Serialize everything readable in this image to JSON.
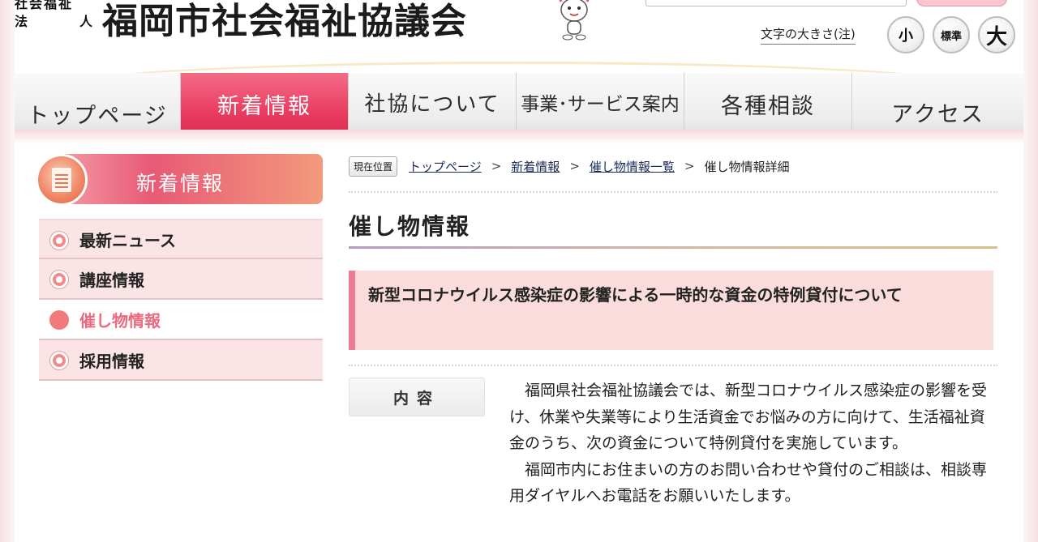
{
  "header": {
    "org_type_line1": "社会福祉",
    "org_type_line2_a": "法",
    "org_type_line2_b": "人",
    "org_name": "福岡市社会福祉協議会",
    "fontsize_label": "文字の大きさ(注)",
    "fontsize_small": "小",
    "fontsize_standard": "標準",
    "fontsize_large": "大"
  },
  "nav": {
    "items": [
      {
        "label": "トップページ"
      },
      {
        "label": "新着情報"
      },
      {
        "label": "社協について"
      },
      {
        "label": "事業･サービス案内"
      },
      {
        "label": "各種相談"
      },
      {
        "label": "アクセス"
      }
    ]
  },
  "sidebar": {
    "title": "新着情報",
    "items": [
      {
        "label": "最新ニュース"
      },
      {
        "label": "講座情報"
      },
      {
        "label": "催し物情報"
      },
      {
        "label": "採用情報"
      }
    ]
  },
  "breadcrumb": {
    "here_label": "現在位置",
    "links": [
      "トップページ",
      "新着情報",
      "催し物情報一覧"
    ],
    "separator": ">",
    "current": "催し物情報詳細"
  },
  "main": {
    "title": "催し物情報",
    "notice": "新型コロナウイルス感染症の影響による一時的な資金の特例貸付について",
    "content_label": "内容",
    "paragraphs": [
      "福岡県社会福祉協議会では、新型コロナウイルス感染症の影響を受け、休業や失業等により生活資金でお悩みの方に向けて、生活福祉資金のうち、次の資金について特例貸付を実施しています。",
      "福岡市内にお住まいの方のお問い合わせや貸付のご相談は、相談専用ダイヤルへお電話をお願いいたします。"
    ]
  },
  "colors": {
    "accent": "#e93a5f",
    "sidebar_bg": "#fbe4e5",
    "notice_bg": "#f9dcdb"
  }
}
